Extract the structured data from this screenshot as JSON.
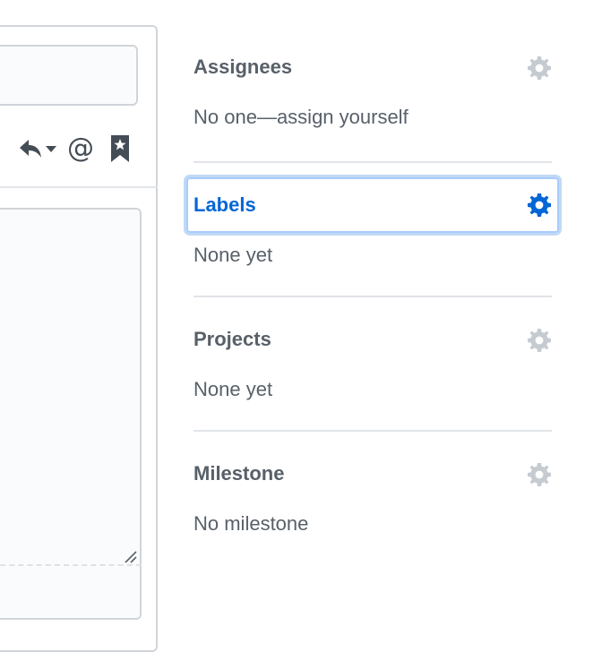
{
  "toolbar": {
    "icons": [
      "reply-icon",
      "chevron-down-icon",
      "mention-icon",
      "bookmark-icon"
    ],
    "mention_symbol": "@"
  },
  "sidebar": {
    "items": [
      {
        "key": "assignees",
        "heading": "Assignees",
        "value": "No one—assign yourself",
        "active": false
      },
      {
        "key": "labels",
        "heading": "Labels",
        "value": "None yet",
        "active": true
      },
      {
        "key": "projects",
        "heading": "Projects",
        "value": "None yet",
        "active": false
      },
      {
        "key": "milestone",
        "heading": "Milestone",
        "value": "No milestone",
        "active": false
      }
    ]
  },
  "colors": {
    "heading_text": "#586069",
    "active_text": "#0366d6",
    "gear_inactive": "#c6cbd1",
    "gear_active": "#0366d6",
    "divider": "#e1e4e8",
    "focus_ring": "#a8ccff"
  }
}
